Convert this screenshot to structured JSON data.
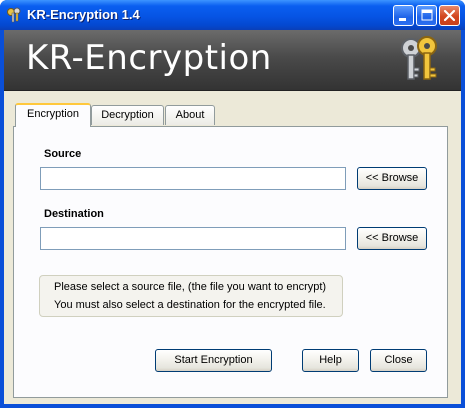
{
  "window": {
    "title": "KR-Encryption 1.4",
    "banner_title": "KR-Encryption",
    "icons": {
      "app": "keys-icon",
      "minimize": "minimize-icon",
      "maximize": "maximize-icon",
      "close": "close-icon"
    }
  },
  "tabs": [
    {
      "label": "Encryption",
      "active": true
    },
    {
      "label": "Decryption",
      "active": false
    },
    {
      "label": "About",
      "active": false
    }
  ],
  "encryption": {
    "source_label": "Source",
    "source_value": "",
    "source_browse": "<< Browse",
    "destination_label": "Destination",
    "destination_value": "",
    "destination_browse": "<< Browse",
    "info_line1": "Please select a source file, (the file you want to encrypt)",
    "info_line2": "You must also select a destination for the encrypted file."
  },
  "buttons": {
    "start": "Start Encryption",
    "help": "Help",
    "close": "Close"
  },
  "colors": {
    "title_bar": "#0654e4",
    "banner": "#4a4a4a",
    "tab_highlight": "#ffc83c",
    "dialog_bg": "#ece9d8"
  }
}
